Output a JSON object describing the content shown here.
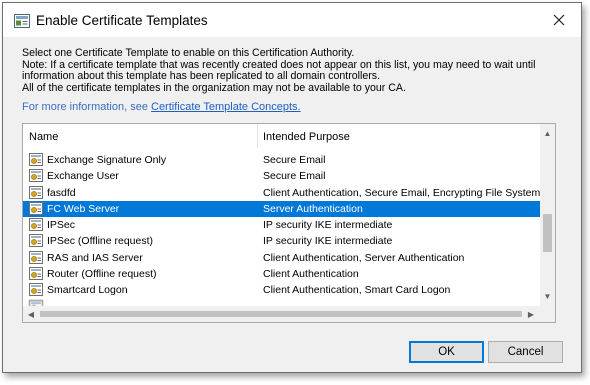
{
  "window": {
    "title": "Enable Certificate Templates",
    "close_glyph": "✕"
  },
  "intro": {
    "line1": "Select one Certificate Template to enable on this Certification Authority.",
    "line2": "Note: If a certificate template that was recently created does not appear on this list, you may need to wait until",
    "line3": "information about this template has been replicated to all domain controllers.",
    "line4": "All of the certificate templates in the organization may not be available to your CA.",
    "more_info_prefix": "For more information, see ",
    "more_info_link": "Certificate Template Concepts."
  },
  "list": {
    "columns": [
      "Name",
      "Intended Purpose"
    ],
    "rows": [
      {
        "name": "Exchange Signature Only",
        "purpose": "Secure Email",
        "selected": false
      },
      {
        "name": "Exchange User",
        "purpose": "Secure Email",
        "selected": false
      },
      {
        "name": "fasdfd",
        "purpose": "Client Authentication, Secure Email, Encrypting File System",
        "selected": false
      },
      {
        "name": "FC Web Server",
        "purpose": "Server Authentication",
        "selected": true
      },
      {
        "name": "IPSec",
        "purpose": "IP security IKE intermediate",
        "selected": false
      },
      {
        "name": "IPSec (Offline request)",
        "purpose": "IP security IKE intermediate",
        "selected": false
      },
      {
        "name": "RAS and IAS Server",
        "purpose": "Client Authentication, Server Authentication",
        "selected": false
      },
      {
        "name": "Router (Offline request)",
        "purpose": "Client Authentication",
        "selected": false
      },
      {
        "name": "Smartcard Logon",
        "purpose": "Client Authentication, Smart Card Logon",
        "selected": false
      }
    ],
    "scroll_up_glyph": "▲",
    "scroll_down_glyph": "▼",
    "scroll_left_glyph": "◀",
    "scroll_right_glyph": "▶",
    "row_icon": "certificate-template-icon"
  },
  "buttons": {
    "ok": "OK",
    "cancel": "Cancel"
  },
  "colors": {
    "selection": "#0078d7",
    "link": "#1f5fbf"
  }
}
